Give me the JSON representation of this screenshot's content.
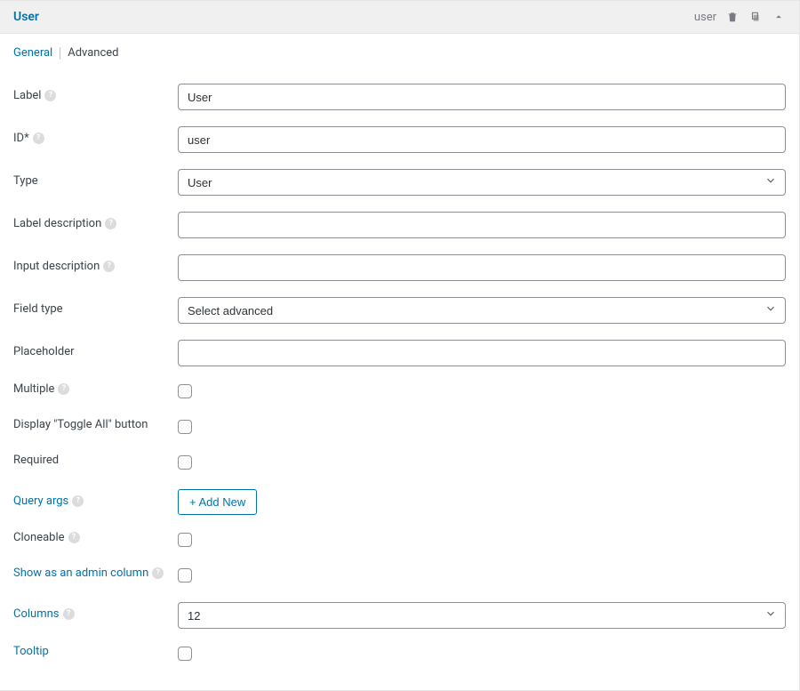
{
  "header": {
    "title": "User",
    "id_tag": "user"
  },
  "tabs": {
    "general": "General",
    "advanced": "Advanced"
  },
  "form": {
    "label_lbl": "Label",
    "label_val": "User",
    "id_lbl": "ID*",
    "id_val": "user",
    "type_lbl": "Type",
    "type_val": "User",
    "labeldesc_lbl": "Label description",
    "labeldesc_val": "",
    "inputdesc_lbl": "Input description",
    "inputdesc_val": "",
    "fieldtype_lbl": "Field type",
    "fieldtype_val": "Select advanced",
    "placeholder_lbl": "Placeholder",
    "placeholder_val": "",
    "multiple_lbl": "Multiple",
    "toggleall_lbl": "Display \"Toggle All\" button",
    "required_lbl": "Required",
    "queryargs_lbl": "Query args",
    "addnew_btn": "+ Add New",
    "cloneable_lbl": "Cloneable",
    "admincol_lbl": "Show as an admin column",
    "columns_lbl": "Columns",
    "columns_val": "12",
    "tooltip_lbl": "Tooltip"
  }
}
